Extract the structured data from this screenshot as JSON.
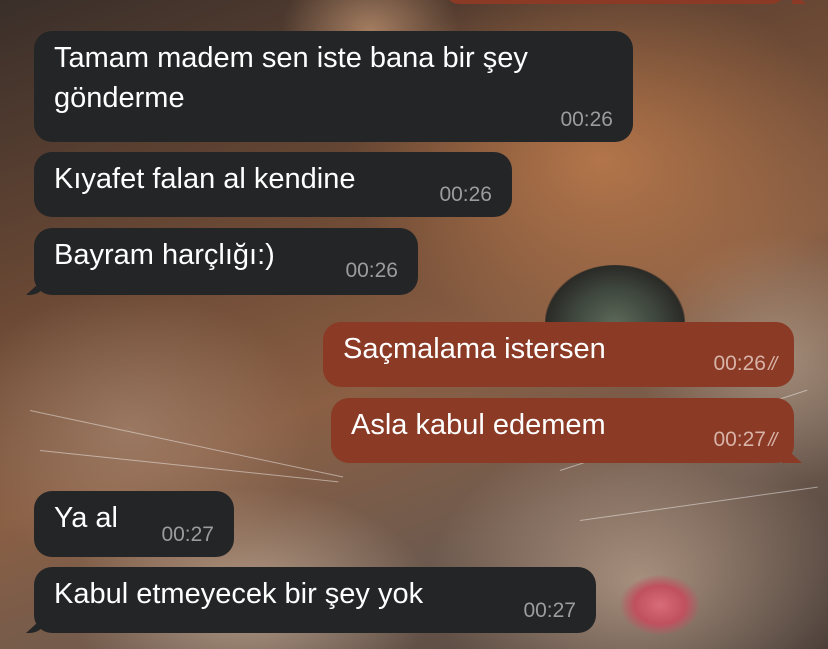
{
  "messages": [
    {
      "direction": "in",
      "text_line1": "Tamam madem sen iste bana bir şey",
      "text_line2": "gönderme",
      "time": "00:26"
    },
    {
      "direction": "in",
      "text": "Kıyafet falan al kendine",
      "time": "00:26"
    },
    {
      "direction": "in",
      "text": "Bayram harçlığı:)",
      "time": "00:26"
    },
    {
      "direction": "out",
      "text": "Saçmalama istersen",
      "time": "00:26",
      "status": "read"
    },
    {
      "direction": "out",
      "text": "Asla kabul edemem",
      "time": "00:27",
      "status": "read"
    },
    {
      "direction": "in",
      "text": "Ya al",
      "time": "00:27"
    },
    {
      "direction": "in",
      "text": "Kabul etmeyecek bir şey yok",
      "time": "00:27"
    }
  ],
  "icons": {
    "read_receipt": "double-check-icon"
  },
  "colors": {
    "incoming_bubble": "#232526",
    "outgoing_bubble": "#8a3a25",
    "text": "#ffffff",
    "timestamp": "#9a9c9e"
  }
}
